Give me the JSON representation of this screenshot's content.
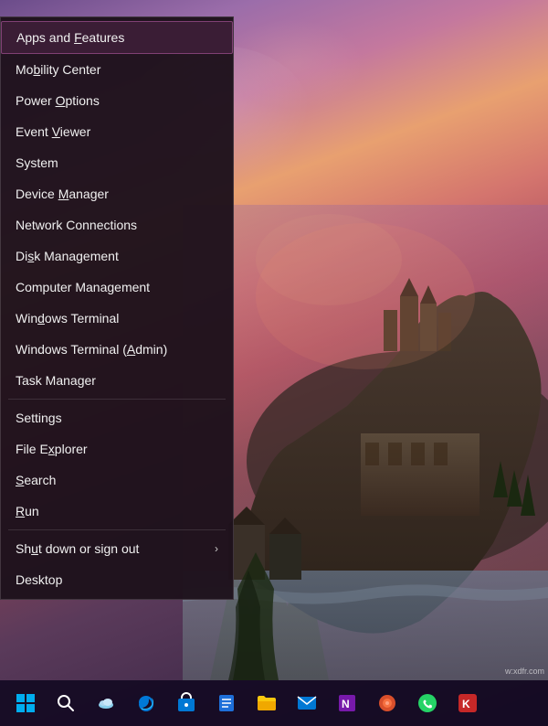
{
  "menu": {
    "items": [
      {
        "id": "apps-features",
        "label": "Apps and Features",
        "highlighted": true,
        "underline_index": 9,
        "has_submenu": false
      },
      {
        "id": "mobility-center",
        "label": "Mobility Center",
        "highlighted": false,
        "underline_index": 2,
        "has_submenu": false
      },
      {
        "id": "power-options",
        "label": "Power Options",
        "highlighted": false,
        "underline_index": 6,
        "has_submenu": false
      },
      {
        "id": "event-viewer",
        "label": "Event Viewer",
        "highlighted": false,
        "underline_index": 6,
        "has_submenu": false
      },
      {
        "id": "system",
        "label": "System",
        "highlighted": false,
        "underline_index": -1,
        "has_submenu": false
      },
      {
        "id": "device-manager",
        "label": "Device Manager",
        "highlighted": false,
        "underline_index": 7,
        "has_submenu": false
      },
      {
        "id": "network-connections",
        "label": "Network Connections",
        "highlighted": false,
        "underline_index": -1,
        "has_submenu": false
      },
      {
        "id": "disk-management",
        "label": "Disk Management",
        "highlighted": false,
        "underline_index": 2,
        "has_submenu": false
      },
      {
        "id": "computer-management",
        "label": "Computer Management",
        "highlighted": false,
        "underline_index": -1,
        "has_submenu": false
      },
      {
        "id": "windows-terminal",
        "label": "Windows Terminal",
        "highlighted": false,
        "underline_index": 8,
        "has_submenu": false
      },
      {
        "id": "windows-terminal-admin",
        "label": "Windows Terminal (Admin)",
        "highlighted": false,
        "underline_index": 8,
        "has_submenu": false
      },
      {
        "id": "task-manager",
        "label": "Task Manager",
        "highlighted": false,
        "underline_index": -1,
        "has_submenu": false
      },
      {
        "id": "settings",
        "label": "Settings",
        "highlighted": false,
        "underline_index": -1,
        "has_submenu": false
      },
      {
        "id": "file-explorer",
        "label": "File Explorer",
        "highlighted": false,
        "underline_index": 5,
        "has_submenu": false
      },
      {
        "id": "search",
        "label": "Search",
        "highlighted": false,
        "underline_index": -1,
        "has_submenu": false
      },
      {
        "id": "run",
        "label": "Run",
        "highlighted": false,
        "underline_index": -1,
        "has_submenu": false
      },
      {
        "id": "shut-down",
        "label": "Shut down or sign out",
        "highlighted": false,
        "underline_index": 2,
        "has_submenu": true
      },
      {
        "id": "desktop",
        "label": "Desktop",
        "highlighted": false,
        "underline_index": -1,
        "has_submenu": false
      }
    ]
  },
  "taskbar": {
    "icons": [
      {
        "id": "start",
        "label": "Start",
        "color": "#0078d4"
      },
      {
        "id": "search",
        "label": "Search",
        "color": "#ffffff"
      },
      {
        "id": "weather",
        "label": "Weather/OneDrive",
        "color": "#29b6f6"
      },
      {
        "id": "edge",
        "label": "Microsoft Edge",
        "color": "#0078d4"
      },
      {
        "id": "store",
        "label": "Microsoft Store",
        "color": "#0078d4"
      },
      {
        "id": "todo",
        "label": "To Do",
        "color": "#1565c0"
      },
      {
        "id": "explorer",
        "label": "File Explorer",
        "color": "#f9c80e"
      },
      {
        "id": "mail",
        "label": "Mail",
        "color": "#0078d4"
      },
      {
        "id": "onenote",
        "label": "OneNote",
        "color": "#7719aa"
      },
      {
        "id": "office",
        "label": "Office",
        "color": "#d94f2b"
      },
      {
        "id": "whatsapp",
        "label": "WhatsApp",
        "color": "#25d366"
      },
      {
        "id": "extra",
        "label": "Extra App",
        "color": "#c62828"
      }
    ]
  },
  "watermark": "w:xdfr.com"
}
